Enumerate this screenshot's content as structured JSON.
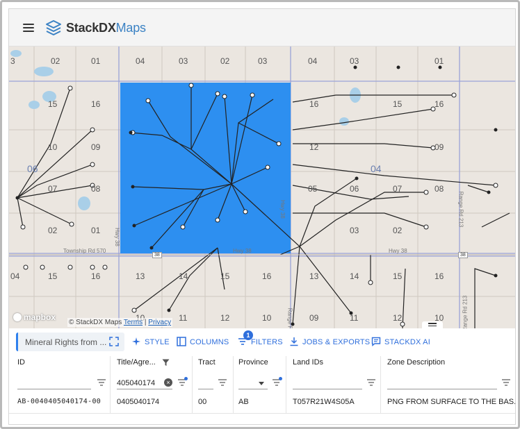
{
  "app": {
    "brand_main": "StackDX",
    "brand_accent": "Maps",
    "accent_color": "#2f6fdc",
    "icons": {
      "menu": "hamburger-icon",
      "logo": "stacked-layers-icon"
    }
  },
  "map": {
    "selected_area_color": "#2d8ff0",
    "section_labels": [
      "3",
      "02",
      "01",
      "04",
      "03",
      "02",
      "03",
      "04",
      "03",
      "01",
      "16",
      "15",
      "16",
      "15",
      "16",
      "10",
      "09",
      "12",
      "09",
      "06",
      "04",
      "07",
      "08",
      "05",
      "06",
      "07",
      "08",
      "02",
      "01",
      "03",
      "02",
      "04",
      "15",
      "16",
      "13",
      "14",
      "15",
      "16",
      "13",
      "14",
      "15",
      "16",
      "10",
      "11",
      "12",
      "10",
      "09",
      "11",
      "12",
      "10",
      "9"
    ],
    "road_labels": [
      "Township Rd 570",
      "Hwy 38",
      "Hwy 38",
      "Hwy 38",
      "Range Rd 213",
      "Range Rd 213",
      "Hwy 38",
      "Range R"
    ],
    "road_shields": [
      "38",
      "38"
    ],
    "attribution_prefix": "© StackDX Maps",
    "attribution_terms": "Terms",
    "attribution_sep": "|",
    "attribution_privacy": "Privacy",
    "mapbox_label": "mapbox"
  },
  "toolbar": {
    "search_text": "Mineral Rights from ...",
    "style_label": "STYLE",
    "columns_label": "COLUMNS",
    "filters_label": "FILTERS",
    "filters_count": "1",
    "jobs_label": "JOBS & EXPORTS",
    "ai_label": "STACKDX AI"
  },
  "grid": {
    "columns": [
      "ID",
      "Title/Agre...",
      "Tract",
      "Province",
      "Land IDs",
      "Zone Description"
    ],
    "title_filter_value": "405040174",
    "rows": [
      {
        "id": "AB-0040405040174-00",
        "title": "0405040174",
        "tract": "00",
        "province": "AB",
        "land_ids": "T057R21W4S05A",
        "zone": "PNG FROM SURFACE TO THE BAS..."
      }
    ]
  }
}
